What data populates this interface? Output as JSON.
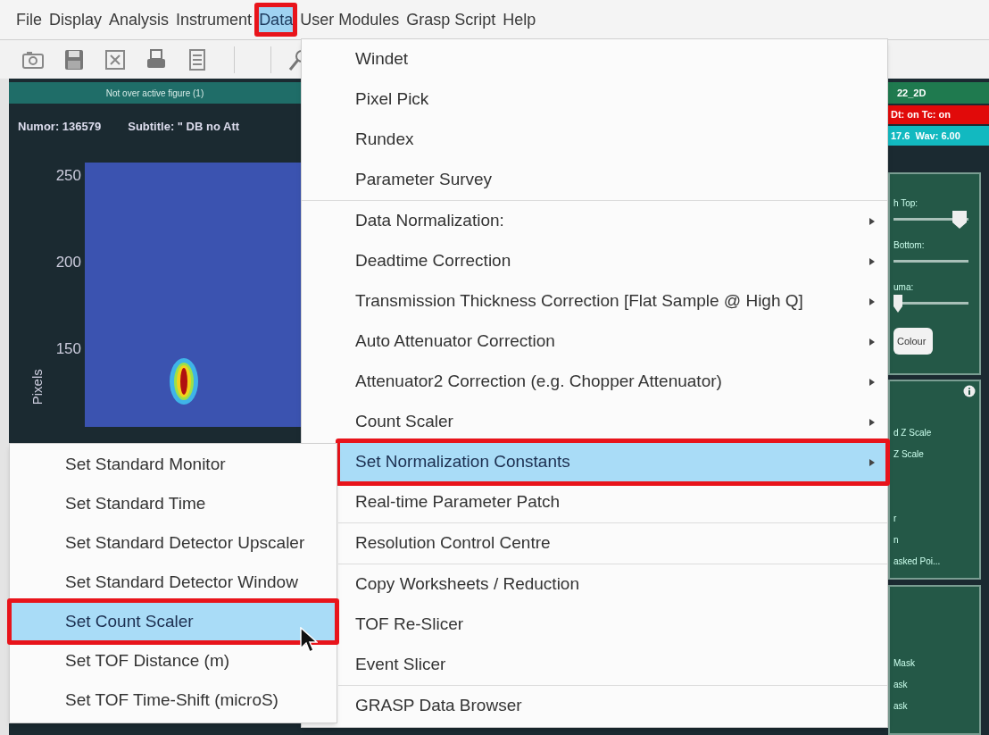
{
  "menubar": [
    {
      "label": "File",
      "selected": false,
      "annotated": false
    },
    {
      "label": "Display",
      "selected": false,
      "annotated": false
    },
    {
      "label": "Analysis",
      "selected": false,
      "annotated": false
    },
    {
      "label": "Instrument",
      "selected": false,
      "annotated": false
    },
    {
      "label": "Data",
      "selected": true,
      "annotated": true
    },
    {
      "label": "User Modules",
      "selected": false,
      "annotated": false
    },
    {
      "label": "Grasp Script",
      "selected": false,
      "annotated": false
    },
    {
      "label": "Help",
      "selected": false,
      "annotated": false
    }
  ],
  "status": {
    "message": "Not over active figure (1)",
    "file": "22_2D",
    "flags": "Dt: on Tc: on",
    "info": "17.6  Wav: 6.00"
  },
  "header": {
    "numor": "Numor: 136579",
    "subtitle": "Subtitle: \" DB no Att"
  },
  "plot": {
    "yticks": [
      "250",
      "200",
      "150"
    ],
    "ylabel": "Pixels"
  },
  "panels": [
    {
      "sliders": [
        {
          "label": "h Top:"
        },
        {
          "label": "Bottom:"
        },
        {
          "label": "uma:"
        }
      ],
      "button": "Colour"
    },
    {
      "info": true,
      "groups": [
        [
          "d Z Scale",
          "Z Scale"
        ],
        [
          "r",
          "n",
          "asked Poi..."
        ]
      ]
    },
    {
      "info": false,
      "groups": [
        [
          "Mask",
          "ask",
          "ask"
        ]
      ]
    }
  ],
  "menu": {
    "items": [
      {
        "label": "Windet",
        "submenu": false,
        "selected": false,
        "annotated": false,
        "separator_before": false
      },
      {
        "label": "Pixel Pick",
        "submenu": false,
        "selected": false,
        "annotated": false,
        "separator_before": false
      },
      {
        "label": "Rundex",
        "submenu": false,
        "selected": false,
        "annotated": false,
        "separator_before": false
      },
      {
        "label": "Parameter Survey",
        "submenu": false,
        "selected": false,
        "annotated": false,
        "separator_before": false
      },
      {
        "label": "Data Normalization:",
        "submenu": true,
        "selected": false,
        "annotated": false,
        "separator_before": true
      },
      {
        "label": "Deadtime Correction",
        "submenu": true,
        "selected": false,
        "annotated": false,
        "separator_before": false
      },
      {
        "label": "Transmission Thickness Correction [Flat Sample @ High Q]",
        "submenu": true,
        "selected": false,
        "annotated": false,
        "separator_before": false
      },
      {
        "label": "Auto Attenuator Correction",
        "submenu": true,
        "selected": false,
        "annotated": false,
        "separator_before": false
      },
      {
        "label": "Attenuator2 Correction (e.g. Chopper Attenuator)",
        "submenu": true,
        "selected": false,
        "annotated": false,
        "separator_before": false
      },
      {
        "label": "Count Scaler",
        "submenu": true,
        "selected": false,
        "annotated": false,
        "separator_before": false
      },
      {
        "label": "Set Normalization Constants",
        "submenu": true,
        "selected": true,
        "annotated": true,
        "separator_before": false
      },
      {
        "label": "Real-time Parameter Patch",
        "submenu": false,
        "selected": false,
        "annotated": false,
        "separator_before": false
      },
      {
        "label": "Resolution Control Centre",
        "submenu": false,
        "selected": false,
        "annotated": false,
        "separator_before": true
      },
      {
        "label": "Copy Worksheets / Reduction",
        "submenu": false,
        "selected": false,
        "annotated": false,
        "separator_before": true
      },
      {
        "label": "TOF Re-Slicer",
        "submenu": false,
        "selected": false,
        "annotated": false,
        "separator_before": false
      },
      {
        "label": "Event Slicer",
        "submenu": false,
        "selected": false,
        "annotated": false,
        "separator_before": false
      },
      {
        "label": "GRASP Data Browser",
        "submenu": false,
        "selected": false,
        "annotated": false,
        "separator_before": true
      }
    ]
  },
  "submenu": {
    "items": [
      {
        "label": "Set Standard Monitor",
        "selected": false,
        "annotated": false
      },
      {
        "label": "Set Standard Time",
        "selected": false,
        "annotated": false
      },
      {
        "label": "Set Standard Detector Upscaler",
        "selected": false,
        "annotated": false
      },
      {
        "label": "Set Standard Detector Window",
        "selected": false,
        "annotated": false
      },
      {
        "label": "Set Count Scaler",
        "selected": true,
        "annotated": true
      },
      {
        "label": "Set TOF Distance (m)",
        "selected": false,
        "annotated": false
      },
      {
        "label": "Set TOF Time-Shift (microS)",
        "selected": false,
        "annotated": false
      }
    ]
  }
}
